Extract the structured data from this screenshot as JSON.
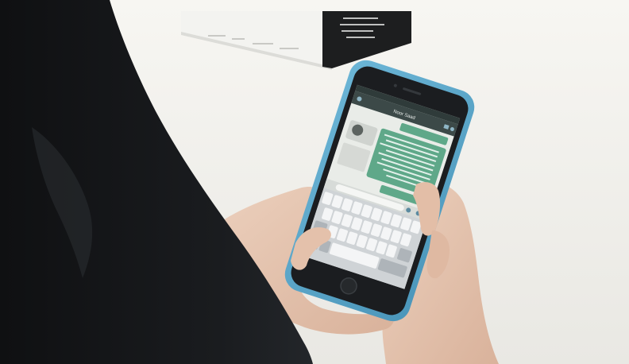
{
  "scene": {
    "palette": {
      "table": "#f1f0ec",
      "hair": "#17191b",
      "case": "#5aa6c9",
      "phone_body": "#1b1d20",
      "screen": "#e9ece8",
      "bubble_sent": "#5fa889",
      "skin": "#e6c3ad",
      "box_black": "#1d1e1f",
      "box_white": "#f4f4f1"
    },
    "phone": {
      "header_name": "Noor Saad"
    }
  }
}
